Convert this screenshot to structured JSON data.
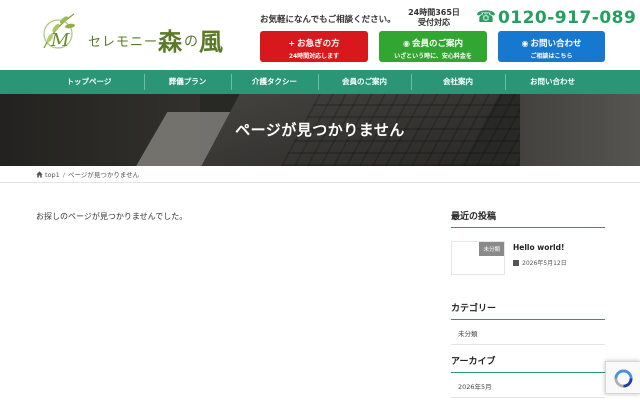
{
  "header": {
    "logo_sub": "セレモニー",
    "logo_main_1": "森",
    "logo_main_no": "の",
    "logo_main_2": "風",
    "tagline": "お気軽になんでもご相談ください。",
    "hours_line1": "24時間365日",
    "hours_line2": "受付対応",
    "phone_number": "0120-917-089",
    "buttons": [
      {
        "icon": "+",
        "label": "お急ぎの方",
        "sub": "24時間対応します",
        "color": "#d7191d"
      },
      {
        "icon": "◉",
        "label": "会員のご案内",
        "sub": "いざという時に、安心料金を",
        "color": "#31a630"
      },
      {
        "icon": "◉",
        "label": "お問い合わせ",
        "sub": "ご相談はこちら",
        "color": "#1778cf"
      }
    ]
  },
  "nav": {
    "items": [
      "トップページ",
      "葬儀プラン",
      "介護タクシー",
      "会員のご案内",
      "会社案内",
      "お問い合わせ"
    ],
    "color": "#2a9676"
  },
  "hero": {
    "title": "ページが見つかりません"
  },
  "breadcrumb": {
    "home": "top1",
    "separator": "/",
    "current": "ページが見つかりません"
  },
  "main": {
    "message": "お探しのページが見つかりませんでした。"
  },
  "sidebar": {
    "recent_title": "最近の投稿",
    "post": {
      "badge": "未分類",
      "title": "Hello world!",
      "date": "2026年5月12日"
    },
    "categories_title": "カテゴリー",
    "categories": [
      "未分類"
    ],
    "archives_title": "アーカイブ",
    "archives": [
      "2026年5月"
    ]
  }
}
